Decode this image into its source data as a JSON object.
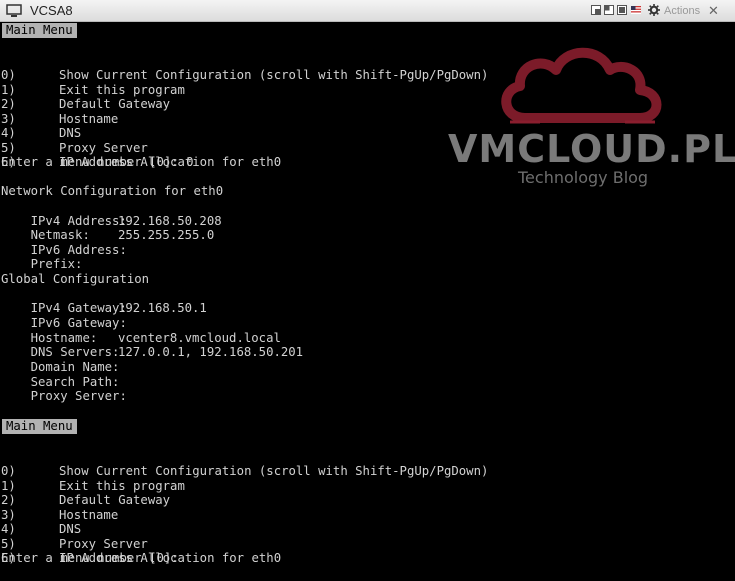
{
  "window": {
    "title": "VCSA8",
    "actions_label": "Actions",
    "close_glyph": "✕"
  },
  "console": {
    "menu_header": "Main Menu",
    "menu_items": [
      {
        "num": "0)",
        "text": "Show Current Configuration (scroll with Shift-PgUp/PgDown)"
      },
      {
        "num": "1)",
        "text": "Exit this program"
      },
      {
        "num": "2)",
        "text": "Default Gateway"
      },
      {
        "num": "3)",
        "text": "Hostname"
      },
      {
        "num": "4)",
        "text": "DNS"
      },
      {
        "num": "5)",
        "text": "Proxy Server"
      },
      {
        "num": "6)",
        "text": "IP Address Allocation for eth0"
      }
    ],
    "prompt_first": "Enter a menu number [0]: 0",
    "network_header": "Network Configuration for eth0",
    "network": [
      {
        "label": "IPv4 Address:",
        "value": "192.168.50.208"
      },
      {
        "label": "Netmask:",
        "value": "255.255.255.0"
      },
      {
        "label": "IPv6 Address:",
        "value": ""
      },
      {
        "label": "Prefix:",
        "value": ""
      }
    ],
    "global_header": "Global Configuration",
    "global": [
      {
        "label": "IPv4 Gateway:",
        "value": "192.168.50.1"
      },
      {
        "label": "IPv6 Gateway:",
        "value": ""
      },
      {
        "label": "Hostname:",
        "value": "vcenter8.vmcloud.local"
      },
      {
        "label": "DNS Servers:",
        "value": "127.0.0.1, 192.168.50.201"
      },
      {
        "label": "Domain Name:",
        "value": ""
      },
      {
        "label": "Search Path:",
        "value": ""
      },
      {
        "label": "Proxy Server:",
        "value": ""
      }
    ],
    "prompt_second": "Enter a menu number [0]:"
  },
  "watermark": {
    "brand": "VMCLOUD.PL",
    "tagline": "Technology Blog",
    "cloud_color": "#8a1e2e",
    "text_color": "#7a7a7a"
  },
  "icons": {
    "window_icon": "monitor-icon",
    "actions_icon": "gear-icon"
  }
}
